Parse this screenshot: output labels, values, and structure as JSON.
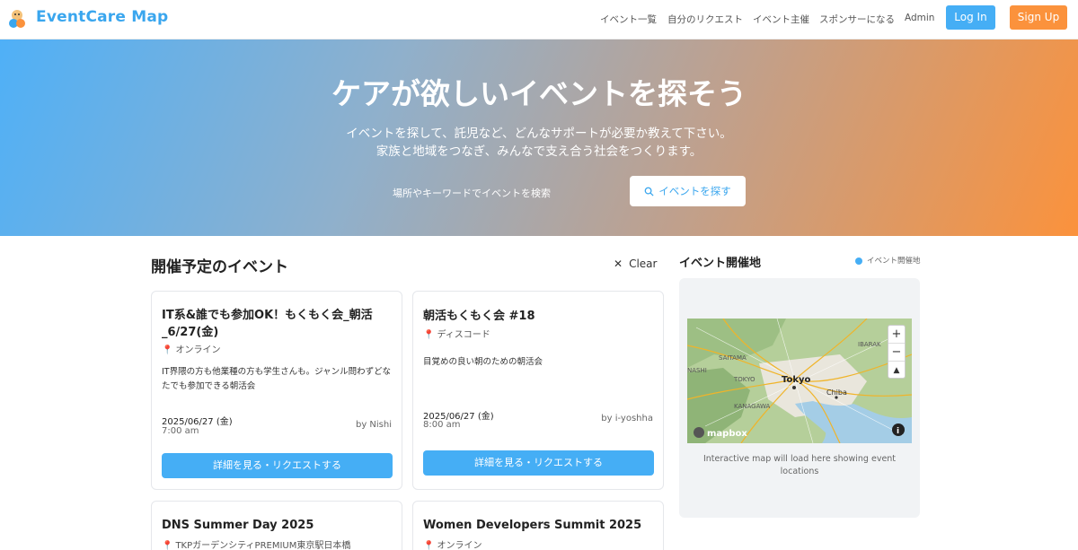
{
  "header": {
    "brand": "EventCare Map",
    "nav": [
      "イベント一覧",
      "自分のリクエスト",
      "イベント主催",
      "スポンサーになる",
      "Admin"
    ],
    "login": "Log In",
    "signup": "Sign Up"
  },
  "hero": {
    "title": "ケアが欲しいイベントを探そう",
    "sub1": "イベントを探して、託児など、どんなサポートが必要か教えて下さい。",
    "sub2": "家族と地域をつなぎ、みんなで支え合う社会をつくります。",
    "search_placeholder": "場所やキーワードでイベントを検索",
    "search_button": "イベントを探す"
  },
  "events": {
    "title": "開催予定のイベント",
    "clear": "Clear",
    "cards": [
      {
        "title": "IT系&誰でも参加OK！もくもく会_朝活_6/27(金)",
        "location": "オンライン",
        "description": "IT界隈の方も他業種の方も学生さんも。ジャンル問わずどなたでも参加できる朝活会",
        "date": "2025/06/27 (金)",
        "time": "7:00 am",
        "by": "by Nishi",
        "cta": "詳細を見る・リクエストする"
      },
      {
        "title": "朝活もくもく会 #18",
        "location": "ディスコード",
        "description": "目覚めの良い朝のための朝活会",
        "date": "2025/06/27 (金)",
        "time": "8:00 am",
        "by": "by i-yoshha",
        "cta": "詳細を見る・リクエストする"
      },
      {
        "title": "DNS Summer Day 2025",
        "location": "TKPガーデンシティPREMIUM東京駅日本橋"
      },
      {
        "title": "Women Developers Summit 2025",
        "location": "オンライン"
      }
    ]
  },
  "map": {
    "title": "イベント開催地",
    "legend": "イベント開催地",
    "labels": [
      "SAITAMA",
      "IBARAK",
      "NASHI",
      "TOKYO",
      "Tokyo",
      "Chiba",
      "KANAGAWA",
      "mapbox"
    ],
    "zoom_in": "+",
    "zoom_out": "−",
    "compass": "▲",
    "note": "Interactive map will load here showing event locations"
  },
  "colors": {
    "primary": "#45aef5",
    "accent": "#fb923c",
    "brand": "#3aa6ee"
  }
}
